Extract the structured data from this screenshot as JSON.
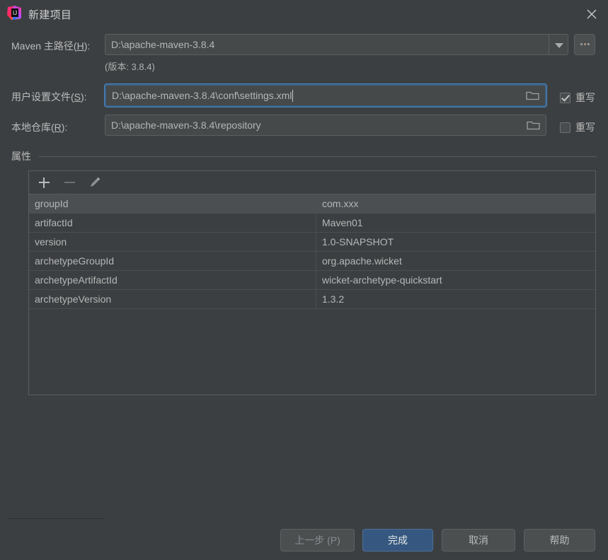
{
  "window": {
    "title": "新建项目",
    "app_icon": "intellij-idea-icon",
    "close_icon": "close-icon",
    "ghost_text": "— .... ..."
  },
  "form": {
    "maven_home": {
      "label_prefix": "Maven 主路径(",
      "mnemonic": "H",
      "label_suffix": "):",
      "value": "D:\\apache-maven-3.8.4",
      "dropdown_icon": "chevron-down-icon",
      "browse_label": "...",
      "version_note": "(版本: 3.8.4)"
    },
    "user_settings": {
      "label_prefix": "用户设置文件(",
      "mnemonic": "S",
      "label_suffix": "):",
      "value": "D:\\apache-maven-3.8.4\\conf\\settings.xml",
      "folder_icon": "folder-icon",
      "override_label": "重写",
      "override_checked": true
    },
    "local_repo": {
      "label_prefix": "本地仓库(",
      "mnemonic": "R",
      "label_suffix": "):",
      "value": "D:\\apache-maven-3.8.4\\repository",
      "folder_icon": "folder-icon",
      "override_label": "重写",
      "override_checked": false
    }
  },
  "properties": {
    "section_label": "属性",
    "toolbar": {
      "add_icon": "plus-icon",
      "remove_icon": "minus-icon",
      "edit_icon": "pencil-icon"
    },
    "rows": [
      {
        "key": "groupId",
        "value": "com.xxx",
        "selected": true
      },
      {
        "key": "artifactId",
        "value": "Maven01",
        "selected": false
      },
      {
        "key": "version",
        "value": "1.0-SNAPSHOT",
        "selected": false
      },
      {
        "key": "archetypeGroupId",
        "value": "org.apache.wicket",
        "selected": false
      },
      {
        "key": "archetypeArtifactId",
        "value": "wicket-archetype-quickstart",
        "selected": false
      },
      {
        "key": "archetypeVersion",
        "value": "1.3.2",
        "selected": false
      }
    ]
  },
  "footer": {
    "back": "上一步 (P)",
    "finish": "完成",
    "cancel": "取消",
    "help": "帮助"
  },
  "colors": {
    "dialog_bg": "#3c3f41",
    "field_bg": "#45494a",
    "focus_border": "#4a88c7",
    "primary_button": "#365880",
    "text": "#bbbbbb"
  }
}
